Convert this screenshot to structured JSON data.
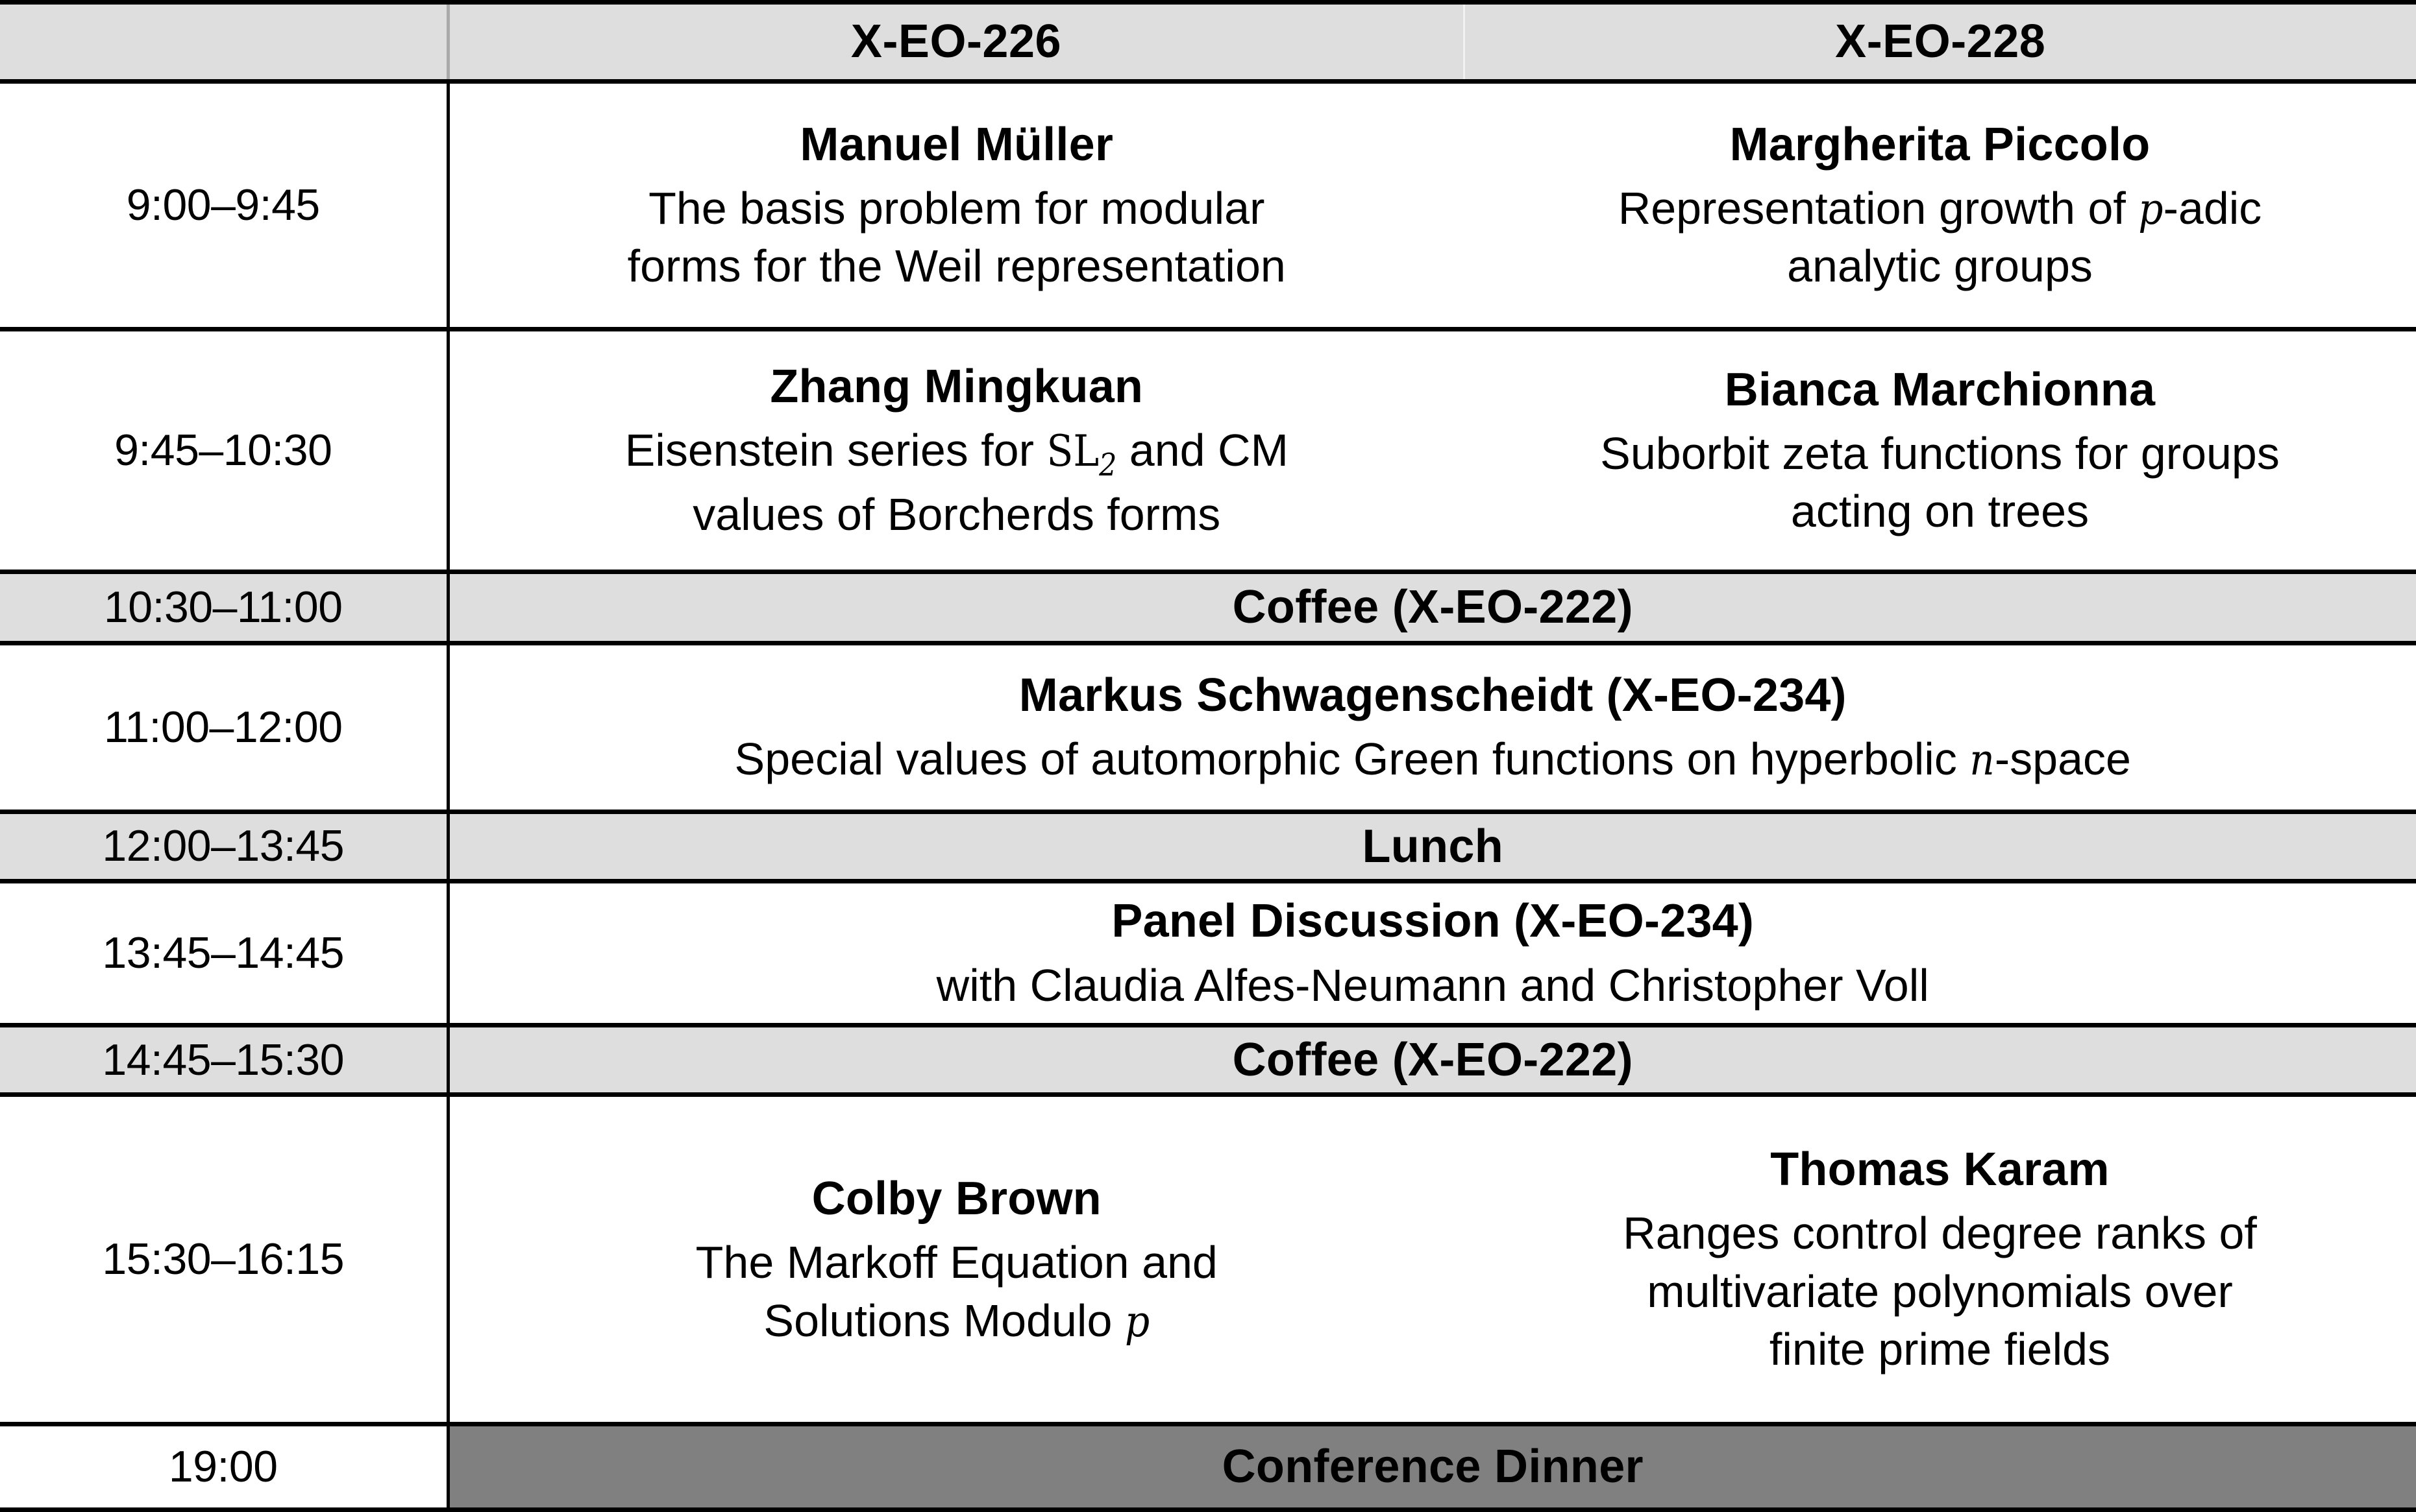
{
  "table": {
    "header": {
      "time_label": "",
      "room_1": "X-EO-226",
      "room_2": "X-EO-228"
    },
    "rows": [
      {
        "time": "9:00–9:45",
        "kind": "two-session",
        "left": {
          "speaker": "Manuel Müller",
          "talk_line_1": "The basis problem for modular",
          "talk_line_2": "forms for the Weil representation"
        },
        "right": {
          "speaker": "Margherita Piccolo",
          "talk_line_1_a": "Representation growth of ",
          "talk_line_1_math": "p",
          "talk_line_1_b": "-adic",
          "talk_line_2": "analytic groups"
        }
      },
      {
        "time": "9:45–10:30",
        "kind": "two-session",
        "left": {
          "speaker": "Zhang Mingkuan",
          "talk_line_1_a": "Eisenstein series for ",
          "talk_line_1_math": "SL",
          "talk_line_1_sub": "2",
          "talk_line_1_b": " and CM",
          "talk_line_2": "values of Borcherds forms"
        },
        "right": {
          "speaker": "Bianca Marchionna",
          "talk_line_1": "Suborbit zeta functions for groups",
          "talk_line_2": "acting on trees"
        }
      },
      {
        "time": "10:30–11:00",
        "kind": "break",
        "label": "Coffee (X-EO-222)"
      },
      {
        "time": "11:00–12:00",
        "kind": "wide",
        "speaker": "Markus Schwagenscheidt (X-EO-234)",
        "talk_a": "Special values of automorphic Green functions on hyperbolic ",
        "talk_math": "n",
        "talk_b": "-space"
      },
      {
        "time": "12:00–13:45",
        "kind": "break",
        "label": "Lunch"
      },
      {
        "time": "13:45–14:45",
        "kind": "wide",
        "speaker": "Panel Discussion (X-EO-234)",
        "talk_a": "with Claudia Alfes-Neumann and Christopher Voll",
        "talk_math": "",
        "talk_b": ""
      },
      {
        "time": "14:45–15:30",
        "kind": "break",
        "label": "Coffee (X-EO-222)"
      },
      {
        "time": "15:30–16:15",
        "kind": "two-session",
        "left": {
          "speaker": "Colby Brown",
          "talk_line_1": "The Markoff Equation and",
          "talk_line_2_a": "Solutions Modulo ",
          "talk_line_2_math": "p"
        },
        "right": {
          "speaker": "Thomas Karam",
          "talk_line_1": "Ranges control degree ranks of",
          "talk_line_2": "multivariate polynomials over",
          "talk_line_3": "finite prime fields"
        }
      },
      {
        "time": "19:00",
        "kind": "dinner",
        "label": "Conference Dinner"
      }
    ]
  },
  "colors": {
    "break_background": "#dedede",
    "header_background": "#dedede",
    "dinner_background": "#808080",
    "dinner_text": "#ffffff",
    "border": "#000000",
    "session_background": "#ffffff"
  }
}
